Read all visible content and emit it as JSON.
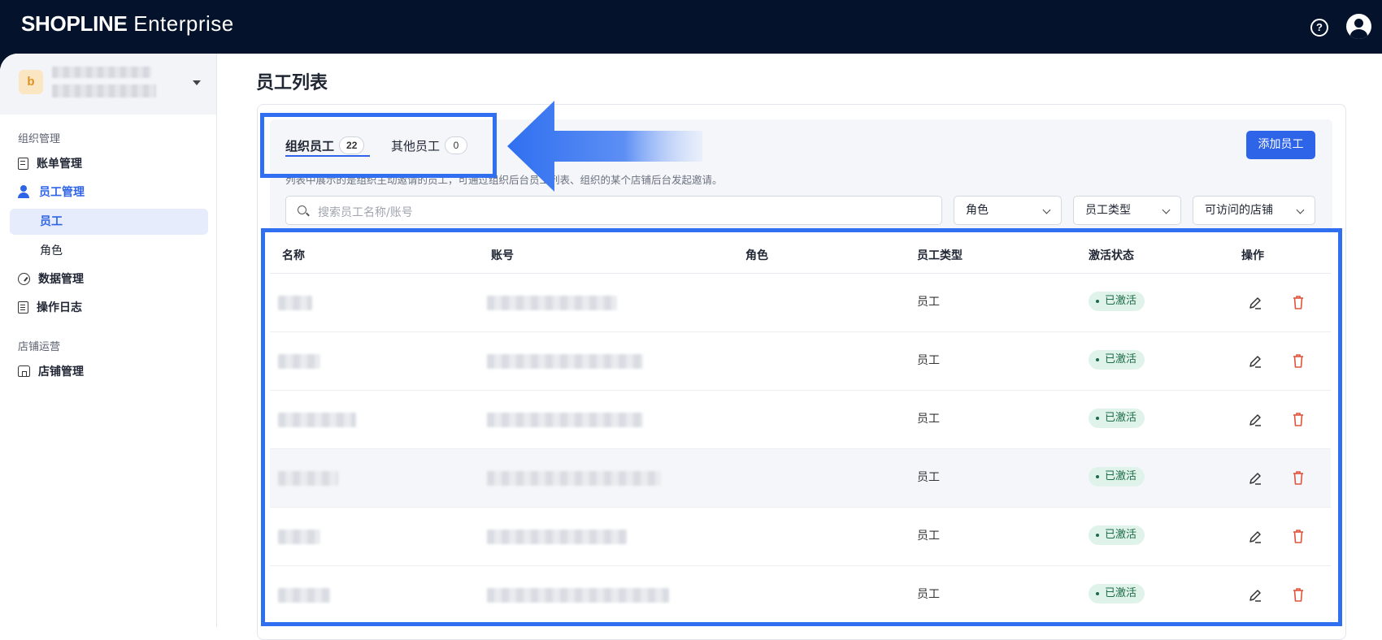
{
  "app": {
    "brand_bold": "SHOPLINE",
    "brand_rest": " Enterprise",
    "help_icon_glyph": "?"
  },
  "sidebar": {
    "store_avatar_letter": "b",
    "sections": [
      {
        "title": "组织管理",
        "items": [
          {
            "label": "账单管理",
            "icon": "bill-icon"
          },
          {
            "label": "员工管理",
            "icon": "staff-icon",
            "active": true,
            "children": [
              {
                "label": "员工",
                "active": true
              },
              {
                "label": "角色"
              }
            ]
          },
          {
            "label": "数据管理",
            "icon": "dashboard-icon"
          },
          {
            "label": "操作日志",
            "icon": "log-icon"
          }
        ]
      },
      {
        "title": "店铺运营",
        "items": [
          {
            "label": "店铺管理",
            "icon": "store-icon"
          }
        ]
      }
    ]
  },
  "main": {
    "page_title": "员工列表",
    "tabs": [
      {
        "label": "组织员工",
        "count": "22",
        "active": true
      },
      {
        "label": "其他员工",
        "count": "0"
      }
    ],
    "add_button": "添加员工",
    "hint": "列表中展示的是组织主动邀请的员工，可通过组织后台员工列表、组织的某个店铺后台发起邀请。",
    "search_placeholder": "搜索员工名称/账号",
    "filters": [
      "角色",
      "员工类型",
      "可访问的店铺"
    ],
    "table": {
      "columns": [
        "名称",
        "账号",
        "角色",
        "员工类型",
        "激活状态",
        "操作"
      ],
      "rows": [
        {
          "type": "员工",
          "status": "已激活"
        },
        {
          "type": "员工",
          "status": "已激活"
        },
        {
          "type": "员工",
          "status": "已激活"
        },
        {
          "type": "员工",
          "status": "已激活"
        },
        {
          "type": "员工",
          "status": "已激活"
        },
        {
          "type": "员工",
          "status": "已激活"
        }
      ]
    }
  },
  "colors": {
    "topbar": "#04132b",
    "accent": "#2e64e8",
    "annotation": "#2f6ff0",
    "status_bg": "#dff3ea",
    "status_text": "#1d6b47",
    "delete": "#e0533d"
  }
}
